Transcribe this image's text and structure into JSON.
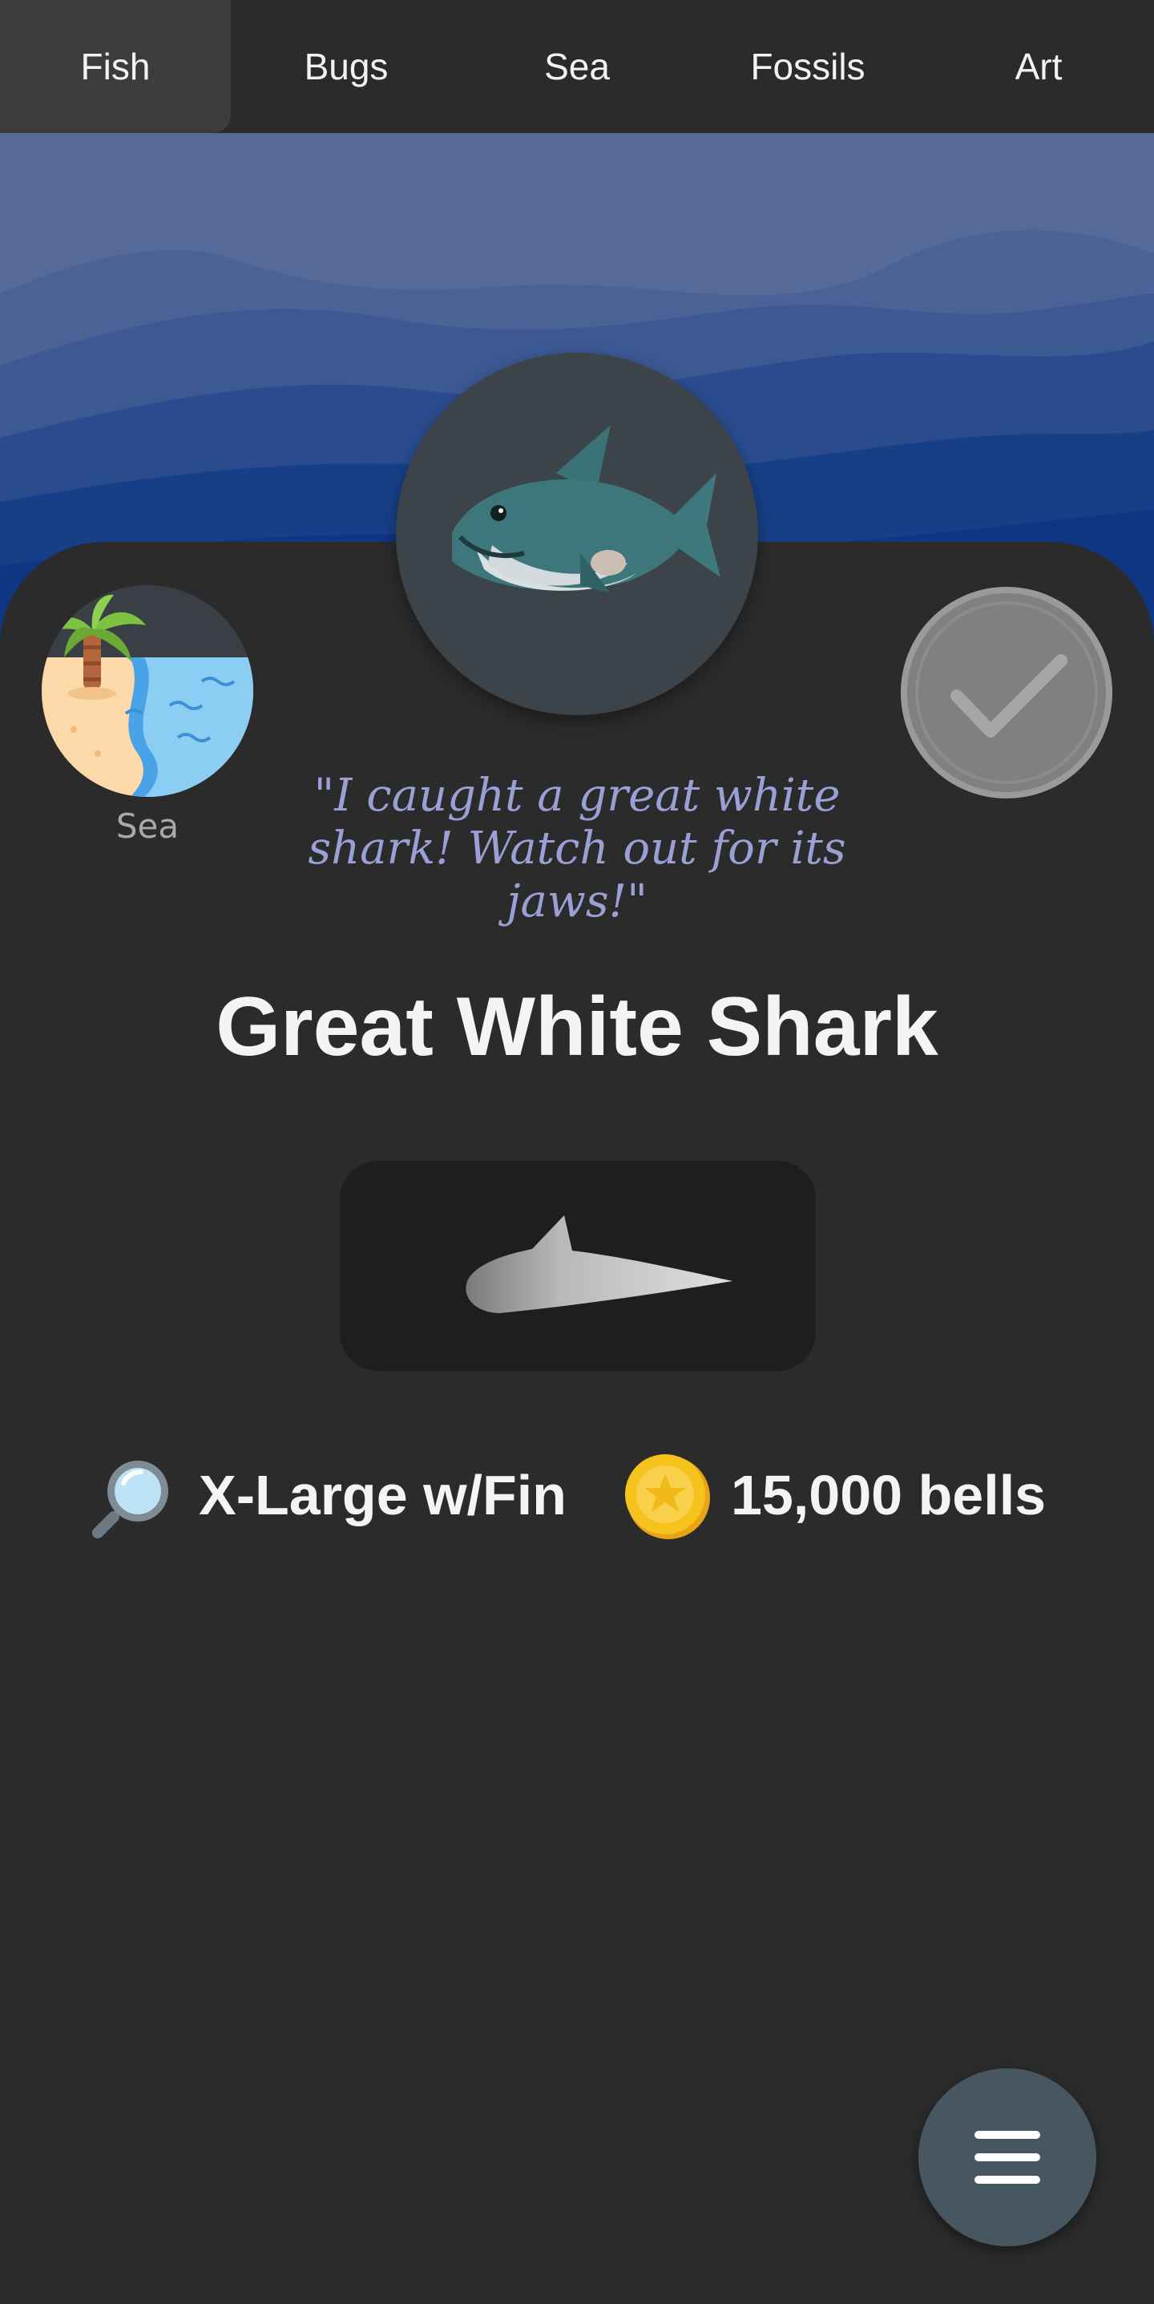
{
  "tabs": [
    {
      "label": "Fish",
      "active": true
    },
    {
      "label": "Bugs",
      "active": false
    },
    {
      "label": "Sea",
      "active": false
    },
    {
      "label": "Fossils",
      "active": false
    },
    {
      "label": "Art",
      "active": false
    }
  ],
  "critter": {
    "name": "Great White Shark",
    "quote": "\"I caught a great white shark! Watch out for its jaws!\"",
    "icon": "shark-icon",
    "caught": false
  },
  "location": {
    "label": "Sea",
    "icon": "beach-icon"
  },
  "stats": {
    "shadow_size": "X-Large w/Fin",
    "shadow_icon": "magnifying-glass-icon",
    "price": "15,000 bells",
    "price_icon": "coin-icon"
  },
  "menu": {
    "icon": "hamburger-menu-icon"
  },
  "colors": {
    "background": "#2b2b2b",
    "active_tab": "#3b3c3b",
    "quote_text": "#9aa0d6",
    "menu_button": "#465762",
    "sea_top": "#556a98",
    "sea_deep": "#0e3a85"
  }
}
